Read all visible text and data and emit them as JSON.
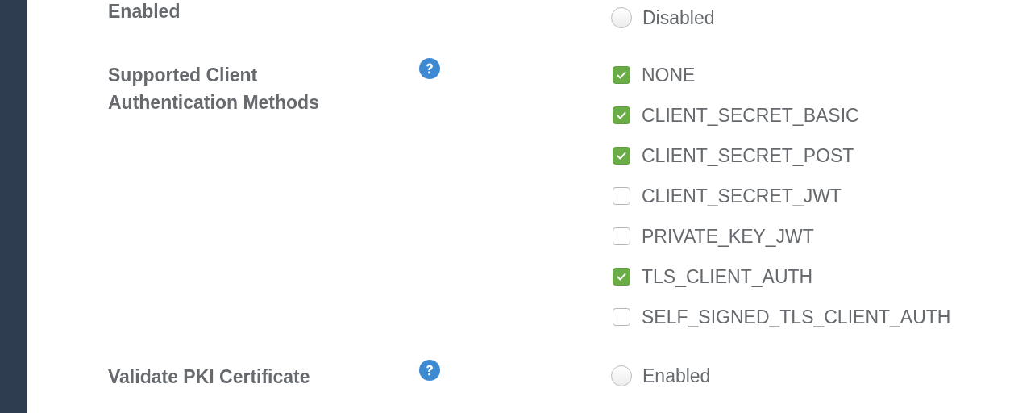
{
  "fields": [
    {
      "label": "Enabled",
      "help": false,
      "options": [
        {
          "kind": "radio",
          "label": "Disabled",
          "selected": false
        }
      ]
    },
    {
      "label": "Supported Client Authentication Methods",
      "help": true,
      "options": [
        {
          "kind": "checkbox",
          "label": "NONE",
          "checked": true
        },
        {
          "kind": "checkbox",
          "label": "CLIENT_SECRET_BASIC",
          "checked": true
        },
        {
          "kind": "checkbox",
          "label": "CLIENT_SECRET_POST",
          "checked": true
        },
        {
          "kind": "checkbox",
          "label": "CLIENT_SECRET_JWT",
          "checked": false
        },
        {
          "kind": "checkbox",
          "label": "PRIVATE_KEY_JWT",
          "checked": false
        },
        {
          "kind": "checkbox",
          "label": "TLS_CLIENT_AUTH",
          "checked": true
        },
        {
          "kind": "checkbox",
          "label": "SELF_SIGNED_TLS_CLIENT_AUTH",
          "checked": false
        }
      ]
    },
    {
      "label": "Validate PKI Certificate",
      "help": true,
      "options": [
        {
          "kind": "radio",
          "label": "Enabled",
          "selected": false
        }
      ]
    }
  ]
}
